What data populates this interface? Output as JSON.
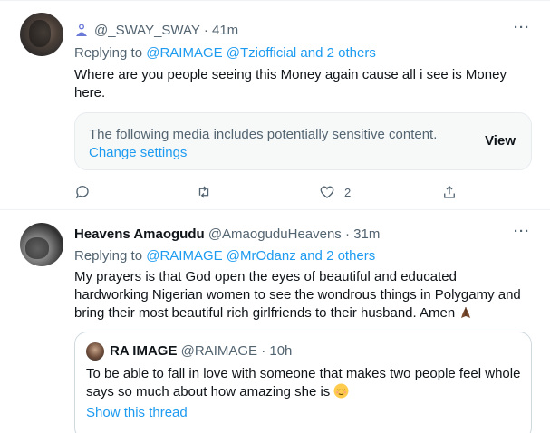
{
  "tweets": [
    {
      "display_name": "@_SWAY_SWAY",
      "handle": "",
      "separator": "·",
      "time": "41m",
      "replying_prefix": "Replying to",
      "replying_links": "@RAIMAGE @Tziofficial and 2 others",
      "text": "Where are you people seeing this Money again cause all i see is Money here.",
      "media_notice": "The following media includes potentially sensitive content.",
      "media_settings": "Change settings",
      "media_view": "View",
      "like_count": "2"
    },
    {
      "display_name": "Heavens Amaogudu",
      "handle": "@AmaoguduHeavens",
      "separator": "·",
      "time": "31m",
      "replying_prefix": "Replying to",
      "replying_links": "@RAIMAGE @MrOdanz and 2 others",
      "text": "My prayers is that God open the eyes of beautiful and educated hardworking Nigerian women to see the wondrous things in Polygamy and bring their most beautiful rich girlfriends to their husband. Amen",
      "quote": {
        "name": "RA IMAGE",
        "handle": "@RAIMAGE",
        "separator": "·",
        "time": "10h",
        "text": "To be able to fall in love with someone that makes two people feel whole says so much about how amazing she is",
        "show_thread": "Show this thread"
      }
    }
  ],
  "icons": {
    "more": "more-dots-icon",
    "reply": "reply-icon",
    "retweet": "retweet-icon",
    "like": "heart-icon",
    "share": "share-icon"
  },
  "colors": {
    "link": "#1d9bf0",
    "secondary_text": "#536471",
    "primary_text": "#0f1419"
  }
}
